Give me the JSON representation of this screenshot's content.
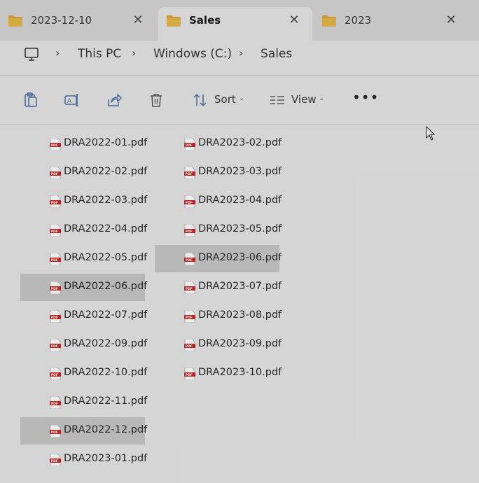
{
  "tabs": [
    {
      "label": "2023-12-10",
      "active": false
    },
    {
      "label": "Sales",
      "active": true
    },
    {
      "label": "2023",
      "active": false
    }
  ],
  "breadcrumb": {
    "items": [
      "This PC",
      "Windows (C:)",
      "Sales"
    ],
    "separator": "›"
  },
  "toolbar": {
    "sort_label": "Sort",
    "view_label": "View",
    "more_label": "•••",
    "icons": [
      "paste-icon",
      "rename-icon",
      "share-icon",
      "delete-icon",
      "sort-icon",
      "view-icon"
    ]
  },
  "files": {
    "column1": [
      {
        "name": "DRA2022-01.pdf",
        "selected": false
      },
      {
        "name": "DRA2022-02.pdf",
        "selected": false
      },
      {
        "name": "DRA2022-03.pdf",
        "selected": false
      },
      {
        "name": "DRA2022-04.pdf",
        "selected": false
      },
      {
        "name": "DRA2022-05.pdf",
        "selected": false
      },
      {
        "name": "DRA2022-06.pdf",
        "selected": true
      },
      {
        "name": "DRA2022-07.pdf",
        "selected": false
      },
      {
        "name": "DRA2022-09.pdf",
        "selected": false
      },
      {
        "name": "DRA2022-10.pdf",
        "selected": false
      },
      {
        "name": "DRA2022-11.pdf",
        "selected": false
      },
      {
        "name": "DRA2022-12.pdf",
        "selected": true
      },
      {
        "name": "DRA2023-01.pdf",
        "selected": false
      }
    ],
    "column2": [
      {
        "name": "DRA2023-02.pdf",
        "selected": false
      },
      {
        "name": "DRA2023-03.pdf",
        "selected": false
      },
      {
        "name": "DRA2023-04.pdf",
        "selected": false
      },
      {
        "name": "DRA2023-05.pdf",
        "selected": false
      },
      {
        "name": "DRA2023-06.pdf",
        "selected": true
      },
      {
        "name": "DRA2023-07.pdf",
        "selected": false
      },
      {
        "name": "DRA2023-08.pdf",
        "selected": false
      },
      {
        "name": "DRA2023-09.pdf",
        "selected": false
      },
      {
        "name": "DRA2023-10.pdf",
        "selected": false
      }
    ]
  },
  "colors": {
    "folder": "#e8b23a",
    "pdf": "#c62828",
    "selection": "#c8c8c8"
  }
}
